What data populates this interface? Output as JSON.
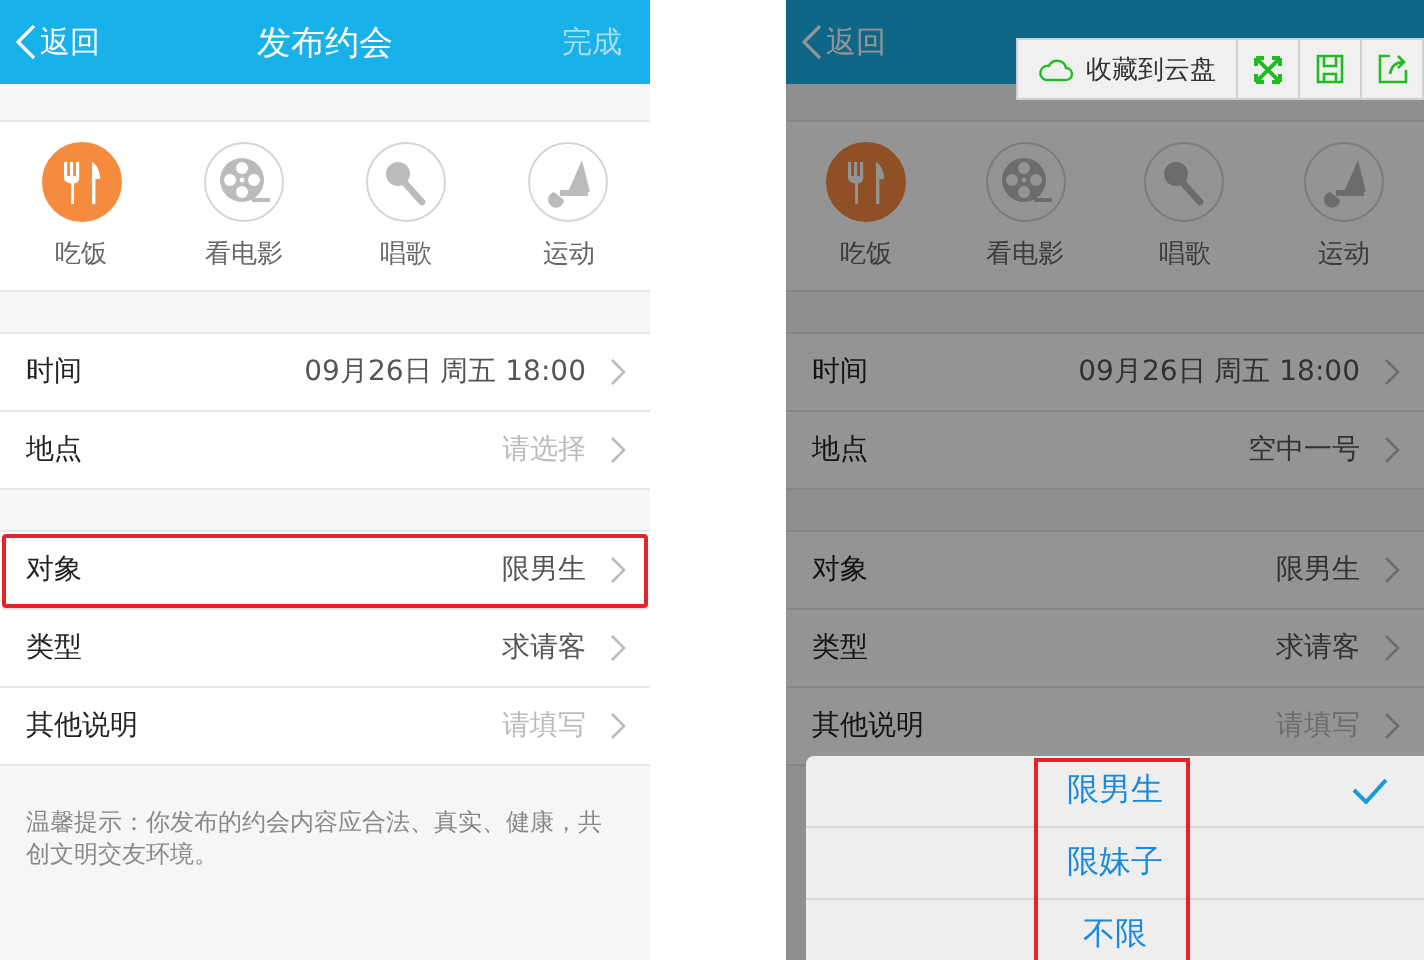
{
  "screens": [
    {
      "back": "返回",
      "title": "发布约会",
      "done": "完成",
      "categories": [
        {
          "kind": "food",
          "label": "吃饭",
          "selected": true
        },
        {
          "kind": "movie",
          "label": "看电影",
          "selected": false
        },
        {
          "kind": "sing",
          "label": "唱歌",
          "selected": false
        },
        {
          "kind": "sport",
          "label": "运动",
          "selected": false
        }
      ],
      "groups": [
        {
          "rows": [
            {
              "label": "时间",
              "value": "09月26日 周五 18:00",
              "highlighted": false
            },
            {
              "label": "地点",
              "placeholder": "请选择",
              "highlighted": false
            }
          ]
        },
        {
          "rows": [
            {
              "label": "对象",
              "value": "限男生",
              "highlighted": true
            },
            {
              "label": "类型",
              "value": "求请客",
              "highlighted": false
            },
            {
              "label": "其他说明",
              "placeholder": "请填写",
              "highlighted": false
            }
          ]
        }
      ],
      "tip": "温馨提示：你发布的约会内容应合法、真实、健康，共创文明交友环境。"
    },
    {
      "dimmed": true,
      "back": "返回",
      "categories": [
        {
          "kind": "food",
          "label": "吃饭",
          "selected": true
        },
        {
          "kind": "movie",
          "label": "看电影",
          "selected": false
        },
        {
          "kind": "sing",
          "label": "唱歌",
          "selected": false
        },
        {
          "kind": "sport",
          "label": "运动",
          "selected": false
        }
      ],
      "groups": [
        {
          "rows": [
            {
              "label": "时间",
              "value": "09月26日 周五 18:00",
              "highlighted": false
            },
            {
              "label": "地点",
              "value": "空中一号",
              "highlighted": false
            }
          ]
        },
        {
          "rows": [
            {
              "label": "对象",
              "value": "限男生",
              "highlighted": false
            },
            {
              "label": "类型",
              "value": "求请客",
              "highlighted": false
            },
            {
              "label": "其他说明",
              "placeholder": "请填写",
              "highlighted": false
            }
          ]
        }
      ],
      "toolbar": {
        "save_label": "收藏到云盘"
      },
      "sheet": {
        "highlighted": true,
        "options": [
          {
            "label": "限男生",
            "selected": true
          },
          {
            "label": "限妹子",
            "selected": false
          },
          {
            "label": "不限",
            "selected": false
          }
        ]
      }
    }
  ]
}
